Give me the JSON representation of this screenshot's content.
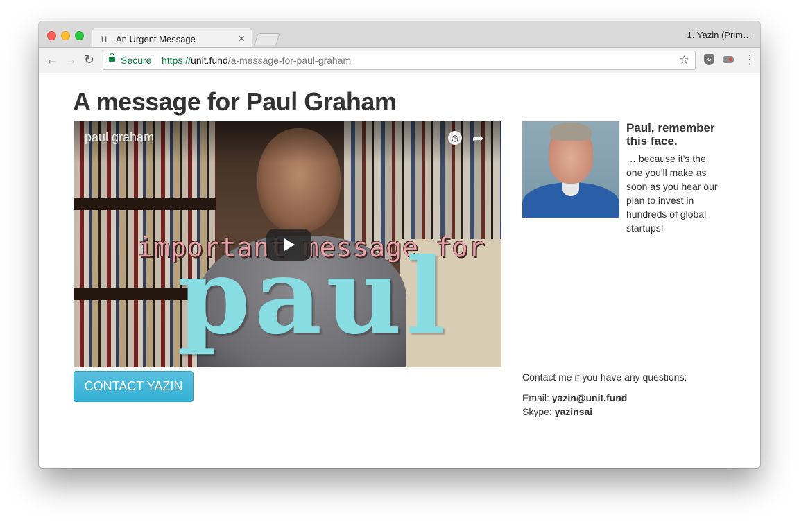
{
  "browser": {
    "tab_title": "An Urgent Message",
    "tab_favicon": "u",
    "tab_close": "×",
    "profile_name": "1. Yazin (Prim…",
    "secure_label": "Secure",
    "url_scheme": "https://",
    "url_host": "unit.fund",
    "url_path": "/a-message-for-paul-graham",
    "back_glyph": "←",
    "forward_glyph": "→",
    "reload_glyph": "↻",
    "star_glyph": "☆",
    "ext1_glyph": "ʊ",
    "menu_glyph": "⋮"
  },
  "page": {
    "title": "A message for Paul Graham",
    "video": {
      "title": "paul graham",
      "overlay_line1": "important message for",
      "overlay_line2": "paul",
      "watch_later_glyph": "◷",
      "share_glyph": "➦"
    },
    "contact_button_label": "CONTACT YAZIN",
    "profile": {
      "heading": "Paul, remember this face.",
      "text": "… because it's the one you'll make as soon as you hear our plan to invest in hundreds of global startups!"
    },
    "contact": {
      "intro": "Contact me if you have any questions:",
      "email_label": "Email:",
      "email_value": "yazin@unit.fund",
      "skype_label": "Skype:",
      "skype_value": "yazinsai"
    }
  },
  "colors": {
    "secure_green": "#0b8043",
    "button_blue": "#31b0d5",
    "overlay_cyan": "#88dde2",
    "overlay_pink": "#e6a1a8"
  }
}
